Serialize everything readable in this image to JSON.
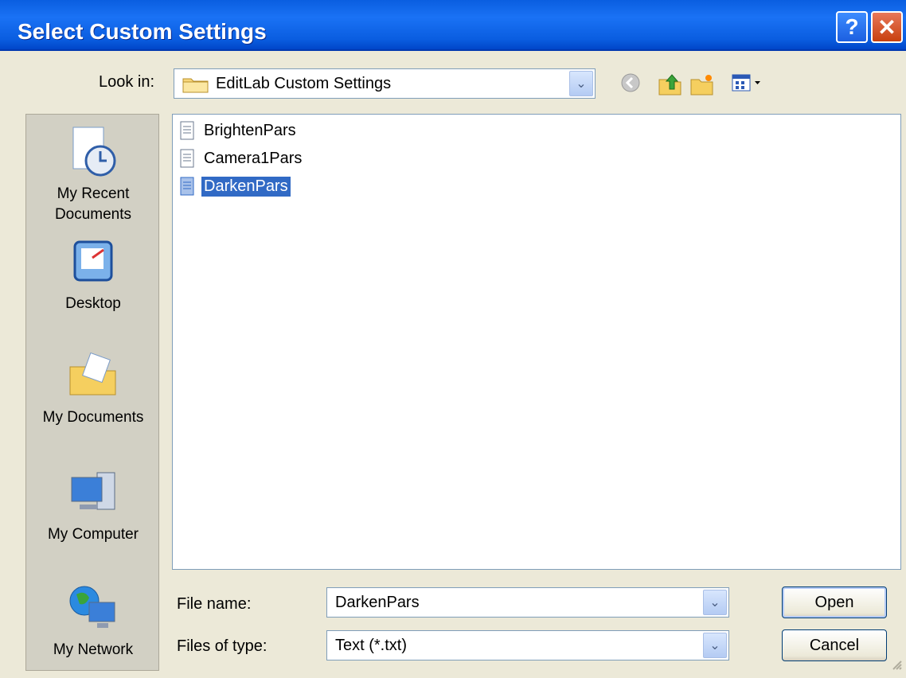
{
  "window": {
    "title": "Select Custom Settings",
    "help_label": "?",
    "close_label": "✕"
  },
  "lookin": {
    "label": "Look in:",
    "value": "EditLab Custom Settings"
  },
  "toolbar": {
    "icons": [
      "back-icon",
      "up-folder-icon",
      "new-folder-icon",
      "view-menu-icon"
    ]
  },
  "places": [
    {
      "label1": "My Recent",
      "label2": "Documents"
    },
    {
      "label1": "Desktop",
      "label2": ""
    },
    {
      "label1": "My Documents",
      "label2": ""
    },
    {
      "label1": "My Computer",
      "label2": ""
    },
    {
      "label1": "My Network",
      "label2": ""
    }
  ],
  "files": [
    {
      "name": "BrightenPars",
      "selected": false
    },
    {
      "name": "Camera1Pars",
      "selected": false
    },
    {
      "name": "DarkenPars",
      "selected": true
    }
  ],
  "filename": {
    "label": "File name:",
    "value": "DarkenPars"
  },
  "filetype": {
    "label": "Files of type:",
    "value": "Text (*.txt)"
  },
  "buttons": {
    "open": "Open",
    "cancel": "Cancel"
  },
  "colors": {
    "titlebar": "#0a5ee0",
    "selection": "#316ac5",
    "dialog": "#ece9d8"
  }
}
